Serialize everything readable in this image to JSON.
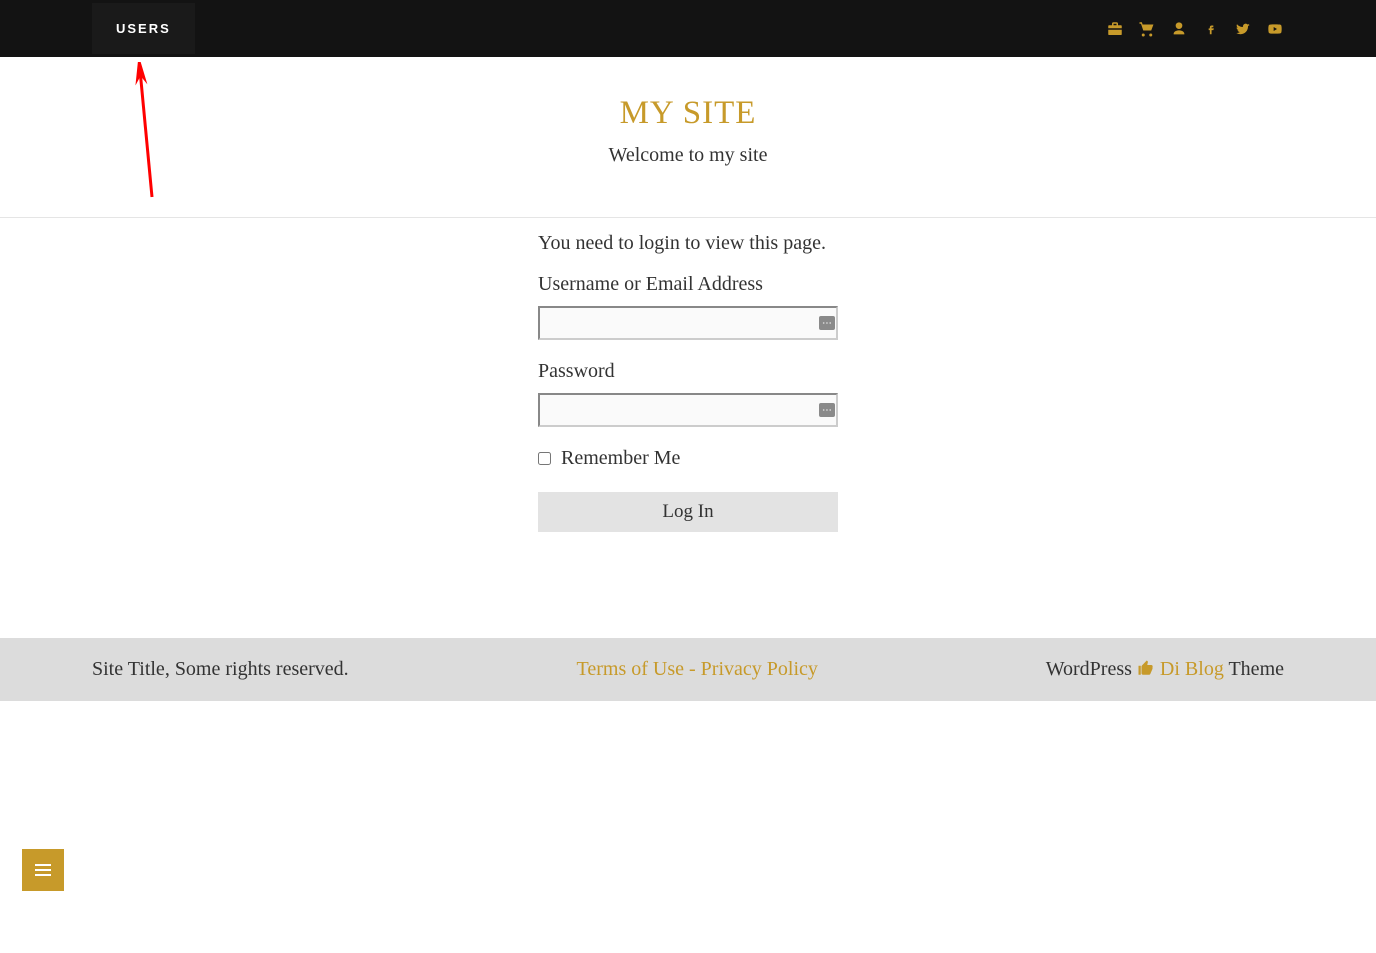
{
  "topbar": {
    "nav_item": "USERS",
    "icons": [
      "briefcase-icon",
      "cart-icon",
      "user-icon",
      "facebook-icon",
      "twitter-icon",
      "youtube-icon"
    ]
  },
  "header": {
    "title": "MY SITE",
    "tagline": "Welcome to my site"
  },
  "login": {
    "message": "You need to login to view this page.",
    "username_label": "Username or Email Address",
    "password_label": "Password",
    "remember_label": "Remember Me",
    "button_label": "Log In"
  },
  "footer": {
    "left": "Site Title, Some rights reserved.",
    "center": "Terms of Use - Privacy Policy",
    "right_wp": "WordPress ",
    "right_diblog": " Di Blog ",
    "right_theme": "Theme"
  },
  "colors": {
    "accent": "#c79a2a",
    "topbar_bg": "#131313",
    "footer_bg": "#dcdcdc"
  }
}
